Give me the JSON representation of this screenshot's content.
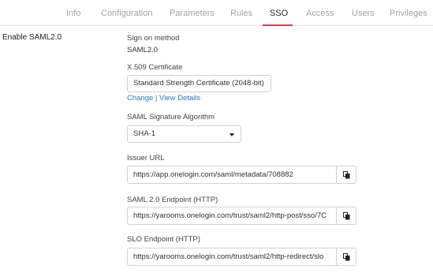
{
  "tabs": [
    {
      "label": "Info"
    },
    {
      "label": "Configuration"
    },
    {
      "label": "Parameters"
    },
    {
      "label": "Rules"
    },
    {
      "label": "SSO"
    },
    {
      "label": "Access"
    },
    {
      "label": "Users"
    },
    {
      "label": "Privileges"
    }
  ],
  "active_tab": "SSO",
  "accent_color": "#e0394a",
  "link_color": "#2a7ab8",
  "section_label": "Enable SAML2.0",
  "sign_on": {
    "label": "Sign on method",
    "value": "SAML2.0"
  },
  "certificate": {
    "label": "X.509 Certificate",
    "value": "Standard Strength Certificate (2048-bit)",
    "change_link": "Change",
    "separator": "|",
    "view_link": "View Details"
  },
  "signature": {
    "label": "SAML Signature Algorithm",
    "selected": "SHA-1"
  },
  "issuer": {
    "label": "Issuer URL",
    "value": "https://app.onelogin.com/saml/metadata/708882",
    "copy_icon": "clipboard-icon"
  },
  "endpoint": {
    "label": "SAML 2.0 Endpoint (HTTP)",
    "value": "https://yarooms.onelogin.com/trust/saml2/http-post/sso/7C",
    "copy_icon": "clipboard-icon"
  },
  "slo": {
    "label": "SLO Endpoint (HTTP)",
    "value": "https://yarooms.onelogin.com/trust/saml2/http-redirect/slo",
    "copy_icon": "clipboard-icon"
  }
}
